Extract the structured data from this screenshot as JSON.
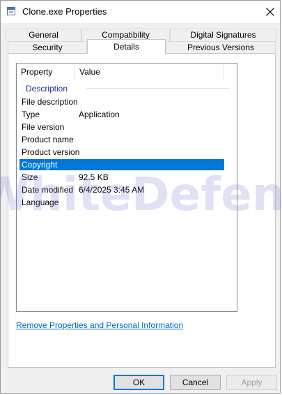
{
  "window": {
    "title": "Clone.exe Properties",
    "icon": "properties-window-icon",
    "close_icon": "close-icon"
  },
  "tabs": {
    "row1": [
      {
        "label": "General"
      },
      {
        "label": "Compatibility"
      },
      {
        "label": "Digital Signatures"
      }
    ],
    "row2": [
      {
        "label": "Security"
      },
      {
        "label": "Details",
        "active": true
      },
      {
        "label": "Previous Versions"
      }
    ]
  },
  "details": {
    "columns": {
      "property": "Property",
      "value": "Value"
    },
    "group": "Description",
    "rows": [
      {
        "name": "File description",
        "value": ""
      },
      {
        "name": "Type",
        "value": "Application"
      },
      {
        "name": "File version",
        "value": ""
      },
      {
        "name": "Product name",
        "value": ""
      },
      {
        "name": "Product version",
        "value": ""
      },
      {
        "name": "Copyright",
        "value": "",
        "selected": true
      },
      {
        "name": "Size",
        "value": "92.5 KB"
      },
      {
        "name": "Date modified",
        "value": "6/4/2025 3:45 AM"
      },
      {
        "name": "Language",
        "value": ""
      }
    ]
  },
  "watermark": "WhiteDefender",
  "link": "Remove Properties and Personal Information",
  "buttons": {
    "ok": "OK",
    "cancel": "Cancel",
    "apply": "Apply"
  },
  "colors": {
    "selection": "#0078d7",
    "group_header": "#1e3287",
    "link": "#0066cc"
  }
}
